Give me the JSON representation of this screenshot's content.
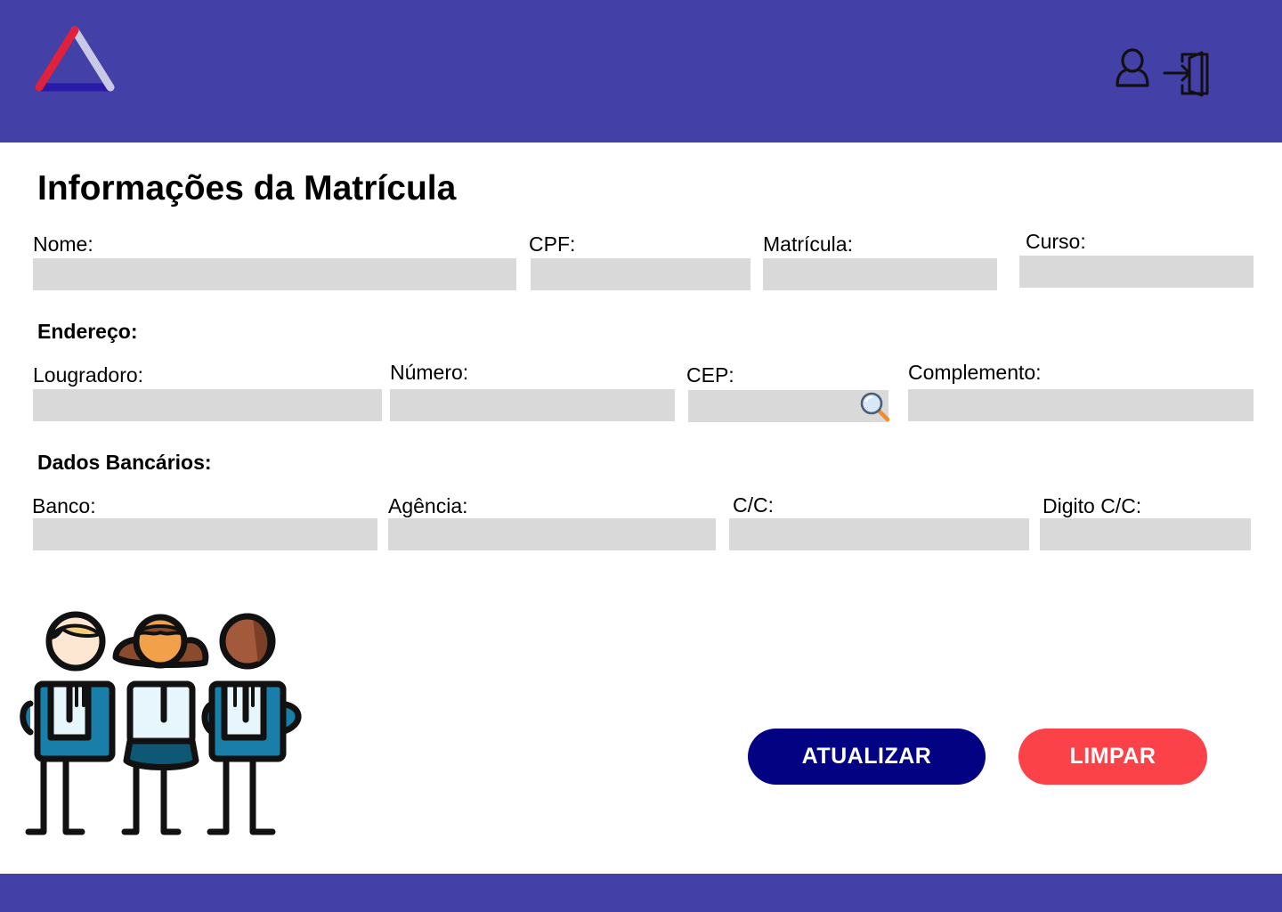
{
  "header": {
    "logo_icon": "triangle-logo-icon",
    "user_icon": "user-icon",
    "logout_icon": "logout-door-icon",
    "color": "#4340A8"
  },
  "page": {
    "title": "Informações da Matrícula"
  },
  "student": {
    "name_label": "Nome:",
    "name_value": "",
    "cpf_label": "CPF:",
    "cpf_value": "",
    "registration_label": "Matrícula:",
    "registration_value": "",
    "course_label": "Curso:",
    "course_value": ""
  },
  "address": {
    "section_title": "Endereço:",
    "street_label": "Lougradoro:",
    "street_value": "",
    "number_label": "Número:",
    "number_value": "",
    "zip_label": "CEP:",
    "zip_value": "",
    "zip_search_icon": "magnifier-icon",
    "complement_label": "Complemento:",
    "complement_value": ""
  },
  "bank": {
    "section_title": "Dados Bancários:",
    "bank_label": "Banco:",
    "bank_value": "",
    "agency_label": "Agência:",
    "agency_value": "",
    "account_label": "C/C:",
    "account_value": "",
    "account_digit_label": "Digito C/C:",
    "account_digit_value": ""
  },
  "actions": {
    "update_label": "ATUALIZAR",
    "clear_label": "LIMPAR",
    "update_color": "#020283",
    "clear_color": "#FB4248"
  },
  "illustration": {
    "icon": "group-of-people-illustration"
  }
}
